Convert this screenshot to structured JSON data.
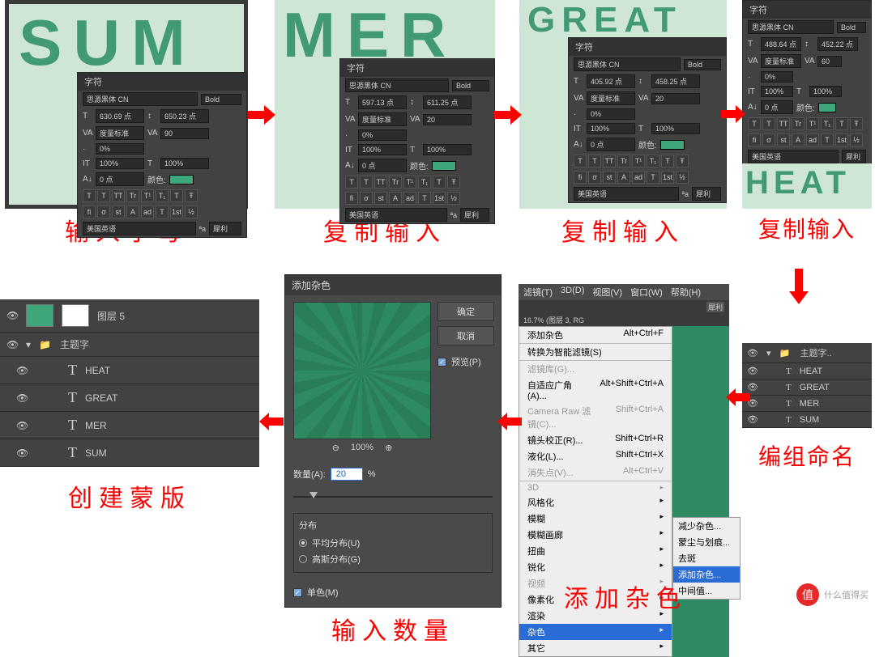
{
  "captions": {
    "step1": "输入字母",
    "step2": "复制输入",
    "step3": "复制输入",
    "step4": "复制输入",
    "step5": "编组命名",
    "step6": "添加杂色",
    "step7": "输入数量",
    "step8": "创建蒙版"
  },
  "canvas_text": {
    "sum": "SUM",
    "mer": "MER",
    "great": "GREAT",
    "heat": "HEAT"
  },
  "char_panel": {
    "title": "字符",
    "font": "思源黑体 CN",
    "weight": "Bold",
    "track_label": "度量标准",
    "aa_label": "度量标准",
    "baseline_label": "0 点",
    "color_label": "颜色:",
    "lang": "美国英语",
    "aa_mode": "犀利",
    "p1": {
      "size": "630.69 点",
      "leading": "650.23 点",
      "track": "90",
      "vscale": "0%",
      "hscale": "100%",
      "aa": "度量标准"
    },
    "p2": {
      "size": "597.13 点",
      "leading": "611.25 点",
      "track": "度量标准",
      "track2": "20",
      "vscale": "0%",
      "hscale": "100%"
    },
    "p3": {
      "size": "405.92 点",
      "leading": "458.25 点",
      "track": "度量标准",
      "track2": "20",
      "vscale": "0%",
      "hscale": "100%"
    },
    "p4": {
      "size": "488.64 点",
      "leading": "452.22 点",
      "track": "度量标准",
      "track2": "60",
      "vscale": "0%",
      "hscale": "100%"
    }
  },
  "color": {
    "green": "#419a74",
    "panel_green": "#3fa57a"
  },
  "layers_small": {
    "group": "主题字..",
    "items": [
      "HEAT",
      "GREAT",
      "MER",
      "SUM"
    ]
  },
  "layers_large": {
    "top": "图层 5",
    "group": "主题字",
    "items": [
      "HEAT",
      "GREAT",
      "MER",
      "SUM"
    ]
  },
  "noise_dialog": {
    "title": "添加杂色",
    "ok": "确定",
    "cancel": "取消",
    "preview": "预览(P)",
    "zoom": "100%",
    "amount_label": "数量(A):",
    "amount_value": "20",
    "amount_unit": "%",
    "dist_label": "分布",
    "dist_uniform": "平均分布(U)",
    "dist_gaussian": "高斯分布(G)",
    "mono": "单色(M)"
  },
  "filter_menu": {
    "bar": [
      "滤镜(T)",
      "3D(D)",
      "视图(V)",
      "窗口(W)",
      "帮助(H)"
    ],
    "tab_info": "16.7% (图层 3, RG",
    "add_noise_top": {
      "label": "添加杂色",
      "shortcut": "Alt+Ctrl+F"
    },
    "convert_smart": "转换为智能滤镜(S)",
    "gallery": "滤镜库(G)...",
    "adaptive": {
      "label": "自适应广角(A)...",
      "shortcut": "Alt+Shift+Ctrl+A"
    },
    "camera_raw": {
      "label": "Camera Raw 滤镜(C)...",
      "shortcut": "Shift+Ctrl+A"
    },
    "lens": {
      "label": "镜头校正(R)...",
      "shortcut": "Shift+Ctrl+R"
    },
    "liquify": {
      "label": "液化(L)...",
      "shortcut": "Shift+Ctrl+X"
    },
    "vanishing": {
      "label": "消失点(V)...",
      "shortcut": "Alt+Ctrl+V"
    },
    "groups": [
      "3D",
      "风格化",
      "模糊",
      "模糊画廊",
      "扭曲",
      "锐化",
      "视频",
      "像素化",
      "渲染",
      "杂色",
      "其它"
    ],
    "noise_sub": [
      "减少杂色...",
      "蒙尘与划痕...",
      "去斑",
      "添加杂色...",
      "中间值..."
    ]
  },
  "watermark": {
    "badge": "值",
    "text": "什么值得买"
  }
}
